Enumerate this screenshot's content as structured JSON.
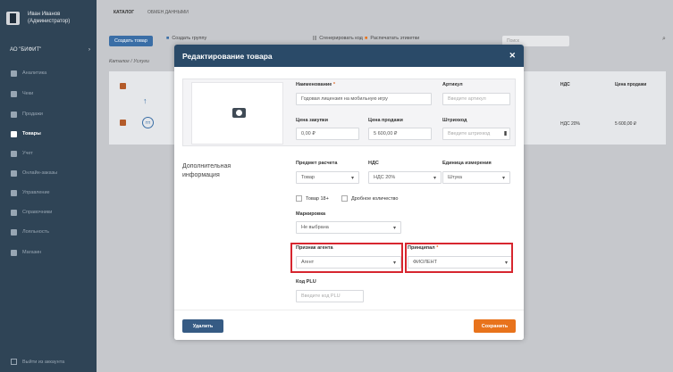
{
  "sidebar": {
    "user_name": "Иван Иванов",
    "user_role": "(Администратор)",
    "org": "АО \"БИФИТ\"",
    "items": [
      {
        "label": "Аналитика",
        "icon": "chart-icon"
      },
      {
        "label": "Чеки",
        "icon": "receipt-icon"
      },
      {
        "label": "Продажи",
        "icon": "sales-icon"
      },
      {
        "label": "Товары",
        "icon": "goods-icon"
      },
      {
        "label": "Учет",
        "icon": "accounting-icon"
      },
      {
        "label": "Онлайн-заказы",
        "icon": "orders-icon"
      },
      {
        "label": "Управление",
        "icon": "management-icon"
      },
      {
        "label": "Справочники",
        "icon": "directory-icon"
      },
      {
        "label": "Лояльность",
        "icon": "loyalty-icon"
      },
      {
        "label": "Магазин",
        "icon": "shop-icon"
      }
    ],
    "logout": "Выйти из аккаунта"
  },
  "tabs": [
    "КАТАЛОГ",
    "ОБМЕН ДАННЫМИ"
  ],
  "toolbar": {
    "create_product": "Создать товар",
    "create_group": "Создать группу",
    "generate_code": "Сгенерировать код",
    "print_labels": "Распечатать этикетки",
    "search_placeholder": "Поиск"
  },
  "breadcrumb": "Каталог / Услуги",
  "table": {
    "headers": {
      "vat": "НДС",
      "price": "Цена продажи"
    },
    "row": {
      "vat": "НДС 20%",
      "price": "5 600,00 ₽",
      "unit": "ГП"
    }
  },
  "modal": {
    "title": "Редактирование товара",
    "name_label": "Наименование",
    "name_value": "Годовая лицензия на мобильную игру",
    "article_label": "Артикул",
    "article_placeholder": "Введите артикул",
    "purchase_label": "Цена закупки",
    "purchase_value": "0,00 ₽",
    "sale_label": "Цена продажи",
    "sale_value": "5 600,00 ₽",
    "barcode_label": "Штрихкод",
    "barcode_placeholder": "Введите штрихкод",
    "section_title_1": "Дополнительная",
    "section_title_2": "информация",
    "subject_label": "Предмет расчета",
    "subject_value": "Товар",
    "vat_label": "НДС",
    "vat_value": "НДС 20%",
    "unit_label": "Единица измерения",
    "unit_value": "Штука",
    "age_label": "Товар 18+",
    "fraction_label": "Дробное количество",
    "marking_label": "Маркировка",
    "marking_value": "Не выбрана",
    "agent_label": "Признак агента",
    "agent_value": "Агент",
    "principal_label": "Принципал",
    "principal_value": "ФИОЛЕНТ",
    "plu_label": "Код PLU",
    "plu_placeholder": "Введите код PLU",
    "delete_button": "Удалить",
    "save_button": "Сохранить"
  },
  "colors": {
    "sidebar": "#2f4456",
    "modal_header": "#2a4a68",
    "primary": "#365b84",
    "accent": "#e8731c",
    "highlight": "#d7262f"
  }
}
